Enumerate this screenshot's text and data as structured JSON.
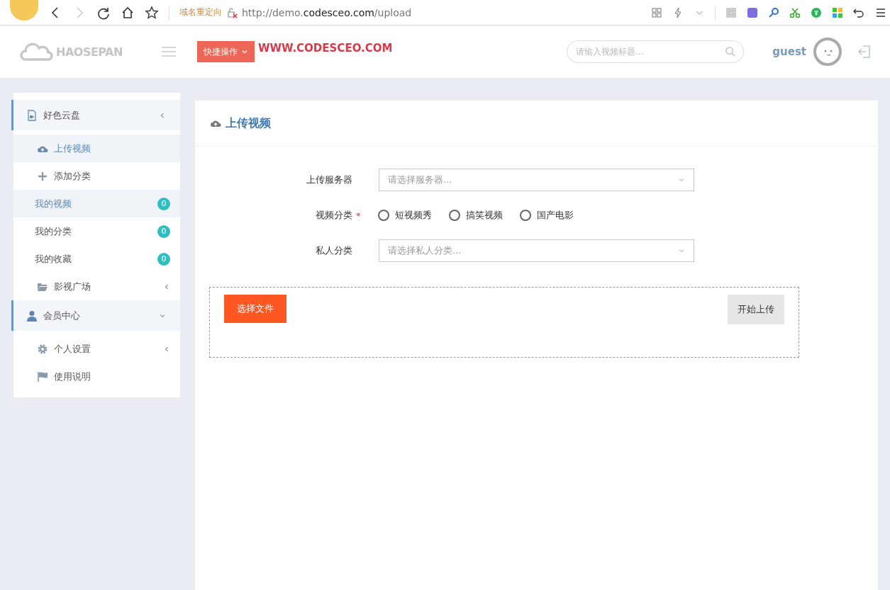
{
  "browser": {
    "redirect_label": "域名重定向",
    "url_prefix": "http://demo.",
    "url_domain": "codesceo.com",
    "url_path": "/upload"
  },
  "header": {
    "logo": "HAOSEPAN",
    "quick_button": "快捷操作",
    "site_link": "WWW.CODESCEO.COM",
    "search": {
      "placeholder": "请输入视频标题..."
    },
    "user": "guest"
  },
  "sidebar": {
    "items": [
      {
        "kind": "group",
        "label": "好色云盘",
        "expanded": false,
        "selected": false
      },
      {
        "kind": "link",
        "label": "上传视频",
        "selected": true
      },
      {
        "kind": "link",
        "label": "添加分类",
        "selected": false
      },
      {
        "kind": "counter",
        "label": "我的视频",
        "count": "0",
        "selected": true
      },
      {
        "kind": "counter",
        "label": "我的分类",
        "count": "0",
        "selected": false
      },
      {
        "kind": "counter",
        "label": "我的收藏",
        "count": "0",
        "selected": false
      },
      {
        "kind": "submenu",
        "label": "影视广场",
        "expanded": false,
        "selected": false
      },
      {
        "kind": "group",
        "label": "会员中心",
        "expanded": true,
        "selected": false
      },
      {
        "kind": "submenu",
        "label": "个人设置",
        "expanded": false,
        "selected": false
      },
      {
        "kind": "link",
        "label": "使用说明",
        "selected": false
      }
    ]
  },
  "panel": {
    "title": "上传视频",
    "server": {
      "label": "上传服务器",
      "placeholder": "请选择服务器..."
    },
    "category": {
      "label": "视频分类",
      "required_mark": "*",
      "options": [
        {
          "label": "短视频秀",
          "selected": false
        },
        {
          "label": "搞笑视频",
          "selected": false
        },
        {
          "label": "国产电影",
          "selected": false
        }
      ]
    },
    "private_category": {
      "label": "私人分类",
      "placeholder": "请选择私人分类..."
    },
    "choose_button": "选择文件",
    "upload_button": "开始上传"
  }
}
